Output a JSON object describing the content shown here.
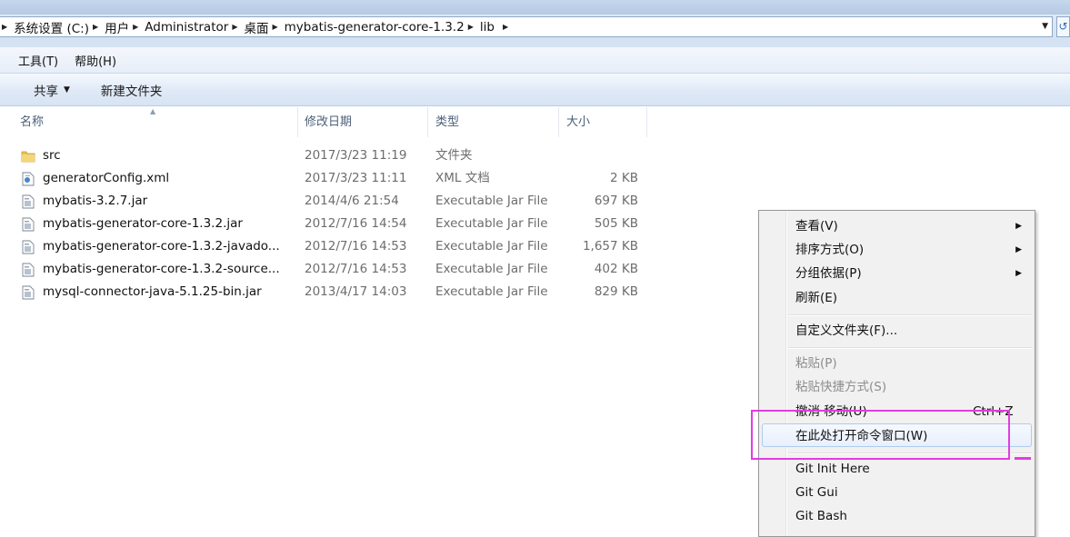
{
  "breadcrumbs": [
    "系统设置 (C:)",
    "用户",
    "Administrator",
    "桌面",
    "mybatis-generator-core-1.3.2",
    "lib"
  ],
  "menu": [
    "工具(T)",
    "帮助(H)"
  ],
  "toolbar": {
    "share": "共享",
    "new_folder": "新建文件夹"
  },
  "columns": {
    "name": "名称",
    "date": "修改日期",
    "type": "类型",
    "size": "大小"
  },
  "files": [
    {
      "icon": "folder-icon",
      "name": "src",
      "date": "2017/3/23 11:19",
      "type": "文件夹",
      "size": ""
    },
    {
      "icon": "xml-file-icon",
      "name": "generatorConfig.xml",
      "date": "2017/3/23 11:11",
      "type": "XML 文档",
      "size": "2 KB"
    },
    {
      "icon": "jar-file-icon",
      "name": "mybatis-3.2.7.jar",
      "date": "2014/4/6 21:54",
      "type": "Executable Jar File",
      "size": "697 KB"
    },
    {
      "icon": "jar-file-icon",
      "name": "mybatis-generator-core-1.3.2.jar",
      "date": "2012/7/16 14:54",
      "type": "Executable Jar File",
      "size": "505 KB"
    },
    {
      "icon": "jar-file-icon",
      "name": "mybatis-generator-core-1.3.2-javado...",
      "date": "2012/7/16 14:53",
      "type": "Executable Jar File",
      "size": "1,657 KB"
    },
    {
      "icon": "jar-file-icon",
      "name": "mybatis-generator-core-1.3.2-source...",
      "date": "2012/7/16 14:53",
      "type": "Executable Jar File",
      "size": "402 KB"
    },
    {
      "icon": "jar-file-icon",
      "name": "mysql-connector-java-5.1.25-bin.jar",
      "date": "2013/4/17 14:03",
      "type": "Executable Jar File",
      "size": "829 KB"
    }
  ],
  "context_menu": {
    "view": "查看(V)",
    "sort_by": "排序方式(O)",
    "group_by": "分组依据(P)",
    "refresh": "刷新(E)",
    "customize": "自定义文件夹(F)...",
    "paste": "粘贴(P)",
    "paste_shortcut": "粘贴快捷方式(S)",
    "undo_move": "撤消 移动(U)",
    "undo_shortcut": "Ctrl+Z",
    "open_cmd": "在此处打开命令窗口(W)",
    "git_init": "Git Init Here",
    "git_gui": "Git Gui",
    "git_bash": "Git Bash"
  },
  "colors": {
    "highlight": "#e33be3",
    "menu_hover_border": "#aecbef"
  }
}
